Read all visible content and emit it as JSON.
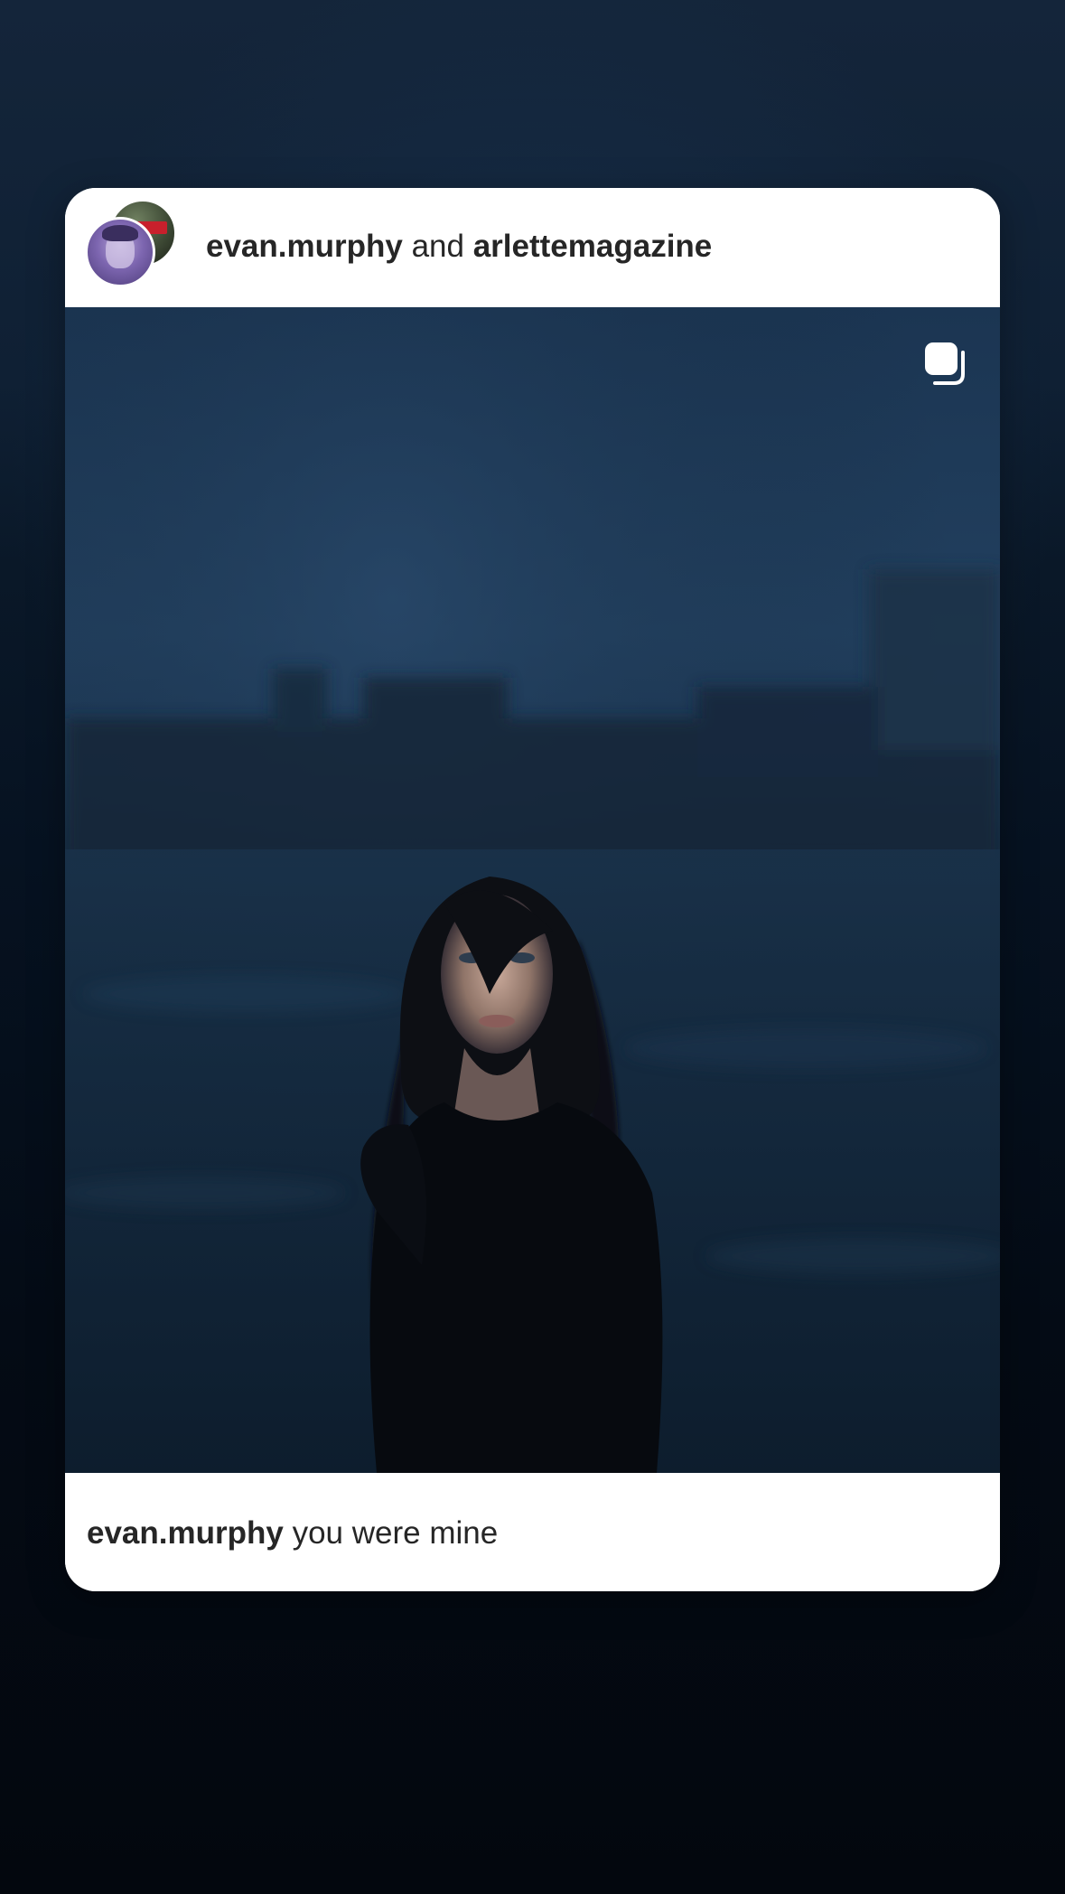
{
  "post": {
    "author": "evan.murphy",
    "connector": " and ",
    "collaborator": "arlettemagazine",
    "caption_author": "evan.murphy",
    "caption_text": " you were mine",
    "multi_media_icon": "carousel-icon",
    "avatar_front_icon": "avatar",
    "avatar_back_icon": "avatar"
  }
}
